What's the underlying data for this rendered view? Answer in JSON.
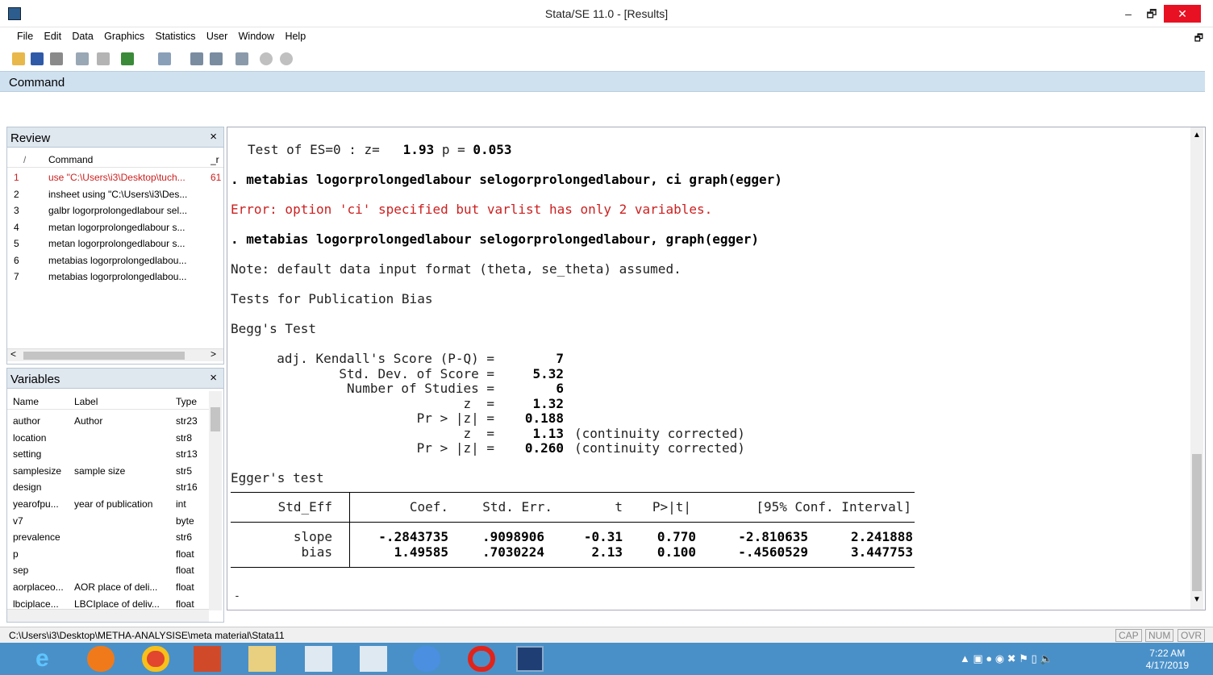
{
  "window": {
    "title": "Stata/SE 11.0 - [Results]",
    "minimize": "–",
    "restore": "🗗",
    "close": "✕"
  },
  "menu": [
    "File",
    "Edit",
    "Data",
    "Graphics",
    "Statistics",
    "User",
    "Window",
    "Help"
  ],
  "command_bar": {
    "label": "Command"
  },
  "review": {
    "title": "Review",
    "close": "×",
    "headers": [
      "/",
      "Command",
      "_r"
    ],
    "rows": [
      {
        "n": "1",
        "cmd": "use \"C:\\Users\\i3\\Desktop\\tuch...",
        "rc": "61",
        "error": true
      },
      {
        "n": "2",
        "cmd": "insheet using \"C:\\Users\\i3\\Des...",
        "rc": ""
      },
      {
        "n": "3",
        "cmd": "galbr logorprolongedlabour sel...",
        "rc": ""
      },
      {
        "n": "4",
        "cmd": "metan logorprolongedlabour s...",
        "rc": ""
      },
      {
        "n": "5",
        "cmd": "metan logorprolongedlabour s...",
        "rc": ""
      },
      {
        "n": "6",
        "cmd": "metabias logorprolongedlabou...",
        "rc": ""
      },
      {
        "n": "7",
        "cmd": "metabias logorprolongedlabou...",
        "rc": ""
      }
    ]
  },
  "variables": {
    "title": "Variables",
    "close": "×",
    "headers": [
      "Name",
      "Label",
      "Type"
    ],
    "rows": [
      {
        "name": "author",
        "label": "Author",
        "type": "str23"
      },
      {
        "name": "location",
        "label": "",
        "type": "str8"
      },
      {
        "name": "setting",
        "label": "",
        "type": "str13"
      },
      {
        "name": "samplesize",
        "label": "sample size",
        "type": "str5"
      },
      {
        "name": "design",
        "label": "",
        "type": "str16"
      },
      {
        "name": "yearofpu...",
        "label": "year of publication",
        "type": "int"
      },
      {
        "name": "v7",
        "label": "",
        "type": "byte"
      },
      {
        "name": "prevalence",
        "label": "",
        "type": "str6"
      },
      {
        "name": "p",
        "label": "",
        "type": "float"
      },
      {
        "name": "sep",
        "label": "",
        "type": "float"
      },
      {
        "name": "aorplaceo...",
        "label": "AOR place of deli...",
        "type": "float"
      },
      {
        "name": "lbciplace...",
        "label": "LBCIplace of deliv...",
        "type": "float"
      }
    ]
  },
  "results": {
    "line1_label": "Test of ES=0 : z=",
    "line1_z": "1.93",
    "line1_p_label": "p = ",
    "line1_p": "0.053",
    "cmd1": ". metabias logorprolongedlabour selogorprolongedlabour, ci graph(egger)",
    "error1": "Error: option 'ci' specified but varlist has only 2 variables.",
    "cmd2": ". metabias logorprolongedlabour selogorprolongedlabour, graph(egger)",
    "note": "Note: default data input format (theta, se_theta) assumed.",
    "heading": "Tests for Publication Bias",
    "begg_title": "Begg's Test",
    "begg": [
      {
        "label": "adj. Kendall's Score (P-Q) =",
        "value": "7",
        "note": ""
      },
      {
        "label": "Std. Dev. of Score =",
        "value": "5.32",
        "note": ""
      },
      {
        "label": "Number of Studies =",
        "value": "6",
        "note": ""
      },
      {
        "label": "z  =",
        "value": "1.32",
        "note": ""
      },
      {
        "label": "Pr > |z| =",
        "value": "0.188",
        "note": ""
      },
      {
        "label": "z  =",
        "value": "1.13",
        "note": "(continuity corrected)"
      },
      {
        "label": "Pr > |z| =",
        "value": "0.260",
        "note": "(continuity corrected)"
      }
    ],
    "egger_title": "Egger's test",
    "egger_headers": [
      "Std_Eff",
      "Coef.",
      "Std. Err.",
      "t",
      "P>|t|",
      "[95% Conf. Interval]"
    ],
    "egger_rows": [
      {
        "name": "slope",
        "coef": "-.2843735",
        "se": ".9098906",
        "t": "-0.31",
        "p": "0.770",
        "lo": "-2.810635",
        "hi": "2.241888"
      },
      {
        "name": "bias",
        "coef": "1.49585",
        "se": ".7030224",
        "t": "2.13",
        "p": "0.100",
        "lo": "-.4560529",
        "hi": "3.447753"
      }
    ],
    "more": "-"
  },
  "status": {
    "path": "C:\\Users\\i3\\Desktop\\METHA-ANALYSISE\\meta material\\Stata11",
    "cap": "CAP",
    "num": "NUM",
    "ovr": "OVR"
  },
  "taskbar": {
    "time": "7:22 AM",
    "date": "4/17/2019"
  }
}
